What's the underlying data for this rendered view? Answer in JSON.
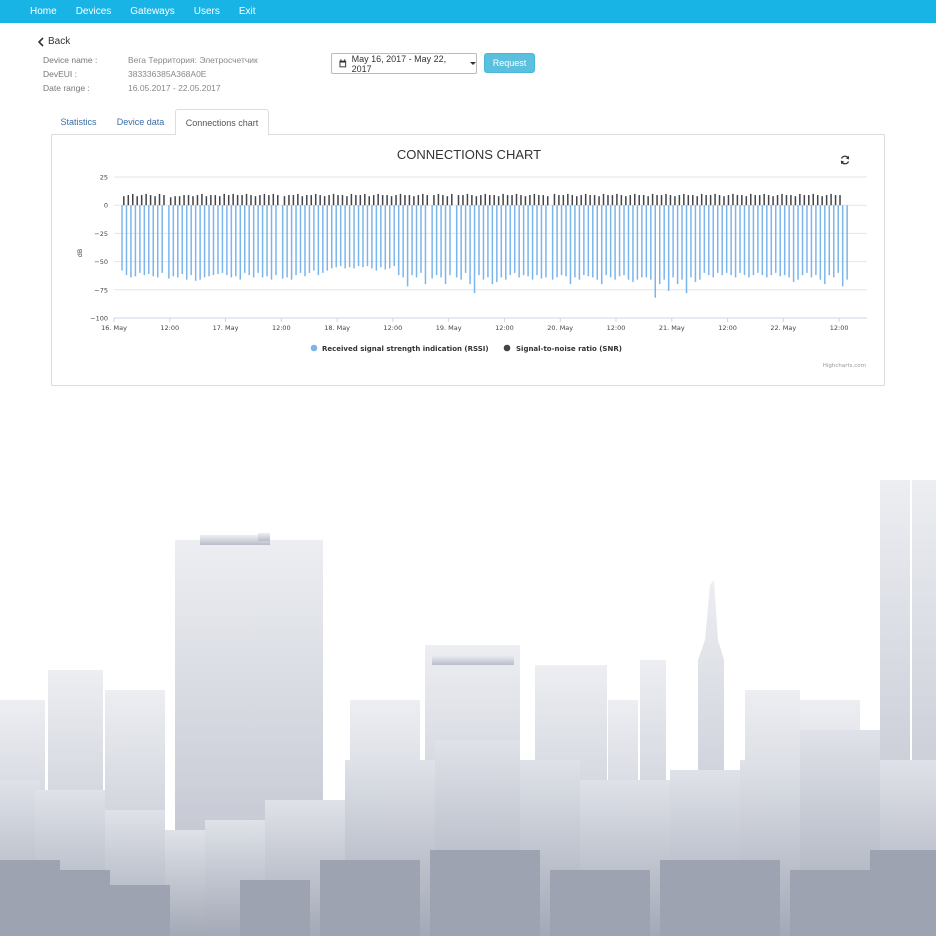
{
  "nav": {
    "items": [
      {
        "label": "Home"
      },
      {
        "label": "Devices"
      },
      {
        "label": "Gateways"
      },
      {
        "label": "Users"
      },
      {
        "label": "Exit"
      }
    ]
  },
  "back_label": "Back",
  "device_info": {
    "name_label": "Device name :",
    "name_value": "Вега Территория: Элетросчетчик",
    "deveui_label": "DevEUI :",
    "deveui_value": "383336385A368A0E",
    "range_label": "Date range :",
    "range_value": "16.05.2017 - 22.05.2017"
  },
  "date_picker": {
    "value": "May 16, 2017 - May 22, 2017",
    "icon": "calendar-icon"
  },
  "request_label": "Request",
  "tabs": [
    {
      "label": "Statistics",
      "active": false
    },
    {
      "label": "Device data",
      "active": false
    },
    {
      "label": "Connections chart",
      "active": true
    }
  ],
  "colors": {
    "navbar": "#17b4e5",
    "rssi": "#7cb5ec",
    "snr": "#434348",
    "button": "#5bc0de",
    "skyline": "#c4c8d2"
  },
  "chart_data": {
    "type": "bar",
    "title": "CONNECTIONS CHART",
    "ylabel": "dB",
    "ylim": [
      -100,
      25
    ],
    "yticks": [
      25,
      0,
      -25,
      -50,
      -75,
      -100
    ],
    "x_ticks": [
      "16. May",
      "12:00",
      "17. May",
      "12:00",
      "18. May",
      "12:00",
      "19. May",
      "12:00",
      "20. May",
      "12:00",
      "21. May",
      "12:00",
      "22. May",
      "12:00"
    ],
    "x_range_days": [
      0.0,
      6.75
    ],
    "grid": true,
    "legend_position": "bottom-center",
    "credits": "Highcharts.com",
    "series": [
      {
        "name": "Received signal strength indication (RSSI)",
        "day_offsets": [
          0.08,
          0.12,
          0.16,
          0.2,
          0.24,
          0.28,
          0.32,
          0.36,
          0.4,
          0.44,
          0.5,
          0.54,
          0.58,
          0.62,
          0.66,
          0.7,
          0.74,
          0.78,
          0.82,
          0.86,
          0.9,
          0.94,
          0.98,
          1.02,
          1.06,
          1.1,
          1.14,
          1.18,
          1.22,
          1.26,
          1.3,
          1.34,
          1.38,
          1.42,
          1.46,
          1.52,
          1.56,
          1.6,
          1.64,
          1.68,
          1.72,
          1.76,
          1.8,
          1.84,
          1.88,
          1.92,
          1.96,
          2.0,
          2.04,
          2.08,
          2.12,
          2.16,
          2.2,
          2.24,
          2.28,
          2.32,
          2.36,
          2.4,
          2.44,
          2.48,
          2.52,
          2.56,
          2.6,
          2.64,
          2.68,
          2.72,
          2.76,
          2.8,
          2.86,
          2.9,
          2.94,
          2.98,
          3.02,
          3.08,
          3.12,
          3.16,
          3.2,
          3.24,
          3.28,
          3.32,
          3.36,
          3.4,
          3.44,
          3.48,
          3.52,
          3.56,
          3.6,
          3.64,
          3.68,
          3.72,
          3.76,
          3.8,
          3.84,
          3.88,
          3.94,
          3.98,
          4.02,
          4.06,
          4.1,
          4.14,
          4.18,
          4.22,
          4.26,
          4.3,
          4.34,
          4.38,
          4.42,
          4.46,
          4.5,
          4.54,
          4.58,
          4.62,
          4.66,
          4.7,
          4.74,
          4.78,
          4.82,
          4.86,
          4.9,
          4.94,
          4.98,
          5.02,
          5.06,
          5.1,
          5.14,
          5.18,
          5.22,
          5.26,
          5.3,
          5.34,
          5.38,
          5.42,
          5.46,
          5.5,
          5.54,
          5.58,
          5.62,
          5.66,
          5.7,
          5.74,
          5.78,
          5.82,
          5.86,
          5.9,
          5.94,
          5.98,
          6.02,
          6.06,
          6.1,
          6.14,
          6.18,
          6.22,
          6.26,
          6.3,
          6.34,
          6.38,
          6.42,
          6.46,
          6.5,
          6.54,
          6.58,
          6.62,
          6.66,
          6.7
        ],
        "values": [
          -58,
          -62,
          -64,
          -63,
          -60,
          -62,
          -61,
          -63,
          -64,
          -60,
          -65,
          -63,
          -64,
          -61,
          -66,
          -62,
          -67,
          -66,
          -64,
          -63,
          -62,
          -61,
          -60,
          -62,
          -64,
          -63,
          -66,
          -60,
          -62,
          -64,
          -60,
          -64,
          -63,
          -66,
          -62,
          -65,
          -64,
          -66,
          -62,
          -60,
          -63,
          -60,
          -58,
          -62,
          -60,
          -58,
          -56,
          -55,
          -54,
          -56,
          -55,
          -56,
          -54,
          -55,
          -54,
          -56,
          -58,
          -55,
          -57,
          -56,
          -54,
          -62,
          -64,
          -72,
          -62,
          -64,
          -60,
          -70,
          -65,
          -62,
          -64,
          -70,
          -62,
          -64,
          -66,
          -60,
          -70,
          -78,
          -62,
          -66,
          -64,
          -70,
          -68,
          -64,
          -66,
          -62,
          -60,
          -64,
          -62,
          -63,
          -66,
          -62,
          -65,
          -64,
          -66,
          -64,
          -62,
          -63,
          -70,
          -64,
          -66,
          -62,
          -63,
          -64,
          -66,
          -70,
          -62,
          -64,
          -66,
          -63,
          -62,
          -66,
          -68,
          -66,
          -64,
          -64,
          -66,
          -82,
          -70,
          -66,
          -76,
          -64,
          -70,
          -66,
          -78,
          -64,
          -68,
          -66,
          -60,
          -62,
          -64,
          -60,
          -62,
          -60,
          -62,
          -64,
          -60,
          -62,
          -64,
          -62,
          -60,
          -62,
          -64,
          -62,
          -60,
          -63,
          -62,
          -64,
          -68,
          -66,
          -62,
          -60,
          -64,
          -62,
          -66,
          -70,
          -62,
          -64,
          -60,
          -72,
          -66
        ]
      },
      {
        "name": "Signal-to-noise ratio (SNR)",
        "day_offsets": [
          0.08,
          0.12,
          0.16,
          0.2,
          0.24,
          0.28,
          0.32,
          0.36,
          0.4,
          0.44,
          0.5,
          0.54,
          0.58,
          0.62,
          0.66,
          0.7,
          0.74,
          0.78,
          0.82,
          0.86,
          0.9,
          0.94,
          0.98,
          1.02,
          1.06,
          1.1,
          1.14,
          1.18,
          1.22,
          1.26,
          1.3,
          1.34,
          1.38,
          1.42,
          1.46,
          1.52,
          1.56,
          1.6,
          1.64,
          1.68,
          1.72,
          1.76,
          1.8,
          1.84,
          1.88,
          1.92,
          1.96,
          2.0,
          2.04,
          2.08,
          2.12,
          2.16,
          2.2,
          2.24,
          2.28,
          2.32,
          2.36,
          2.4,
          2.44,
          2.48,
          2.52,
          2.56,
          2.6,
          2.64,
          2.68,
          2.72,
          2.76,
          2.8,
          2.86,
          2.9,
          2.94,
          2.98,
          3.02,
          3.08,
          3.12,
          3.16,
          3.2,
          3.24,
          3.28,
          3.32,
          3.36,
          3.4,
          3.44,
          3.48,
          3.52,
          3.56,
          3.6,
          3.64,
          3.68,
          3.72,
          3.76,
          3.8,
          3.84,
          3.88,
          3.94,
          3.98,
          4.02,
          4.06,
          4.1,
          4.14,
          4.18,
          4.22,
          4.26,
          4.3,
          4.34,
          4.38,
          4.42,
          4.46,
          4.5,
          4.54,
          4.58,
          4.62,
          4.66,
          4.7,
          4.74,
          4.78,
          4.82,
          4.86,
          4.9,
          4.94,
          4.98,
          5.02,
          5.06,
          5.1,
          5.14,
          5.18,
          5.22,
          5.26,
          5.3,
          5.34,
          5.38,
          5.42,
          5.46,
          5.5,
          5.54,
          5.58,
          5.62,
          5.66,
          5.7,
          5.74,
          5.78,
          5.82,
          5.86,
          5.9,
          5.94,
          5.98,
          6.02,
          6.06,
          6.1,
          6.14,
          6.18,
          6.22,
          6.26,
          6.3,
          6.34,
          6.38,
          6.42,
          6.46,
          6.5,
          6.54,
          6.58,
          6.62,
          6.66,
          6.7
        ],
        "values": [
          8,
          9,
          10,
          8,
          9,
          10,
          9,
          8,
          10,
          9,
          7,
          8,
          8,
          9,
          9,
          8,
          9,
          10,
          8,
          9,
          9,
          8,
          10,
          9,
          10,
          9,
          9,
          10,
          9,
          8,
          9,
          10,
          9,
          10,
          9,
          8,
          9,
          9,
          10,
          8,
          9,
          9,
          10,
          9,
          8,
          9,
          10,
          9,
          9,
          8,
          10,
          9,
          9,
          10,
          8,
          9,
          10,
          9,
          9,
          8,
          9,
          10,
          9,
          9,
          8,
          9,
          10,
          9,
          9,
          10,
          9,
          8,
          10,
          9,
          9,
          10,
          9,
          8,
          9,
          10,
          9,
          9,
          8,
          10,
          9,
          9,
          10,
          9,
          8,
          9,
          10,
          9,
          9,
          8,
          10,
          9,
          9,
          10,
          9,
          8,
          9,
          10,
          9,
          9,
          8,
          10,
          9,
          9,
          10,
          9,
          8,
          9,
          10,
          9,
          9,
          8,
          10,
          9,
          9,
          10,
          9,
          8,
          9,
          10,
          9,
          9,
          8,
          10,
          9,
          9,
          10,
          9,
          8,
          9,
          10,
          9,
          9,
          8,
          10,
          9,
          9,
          10,
          9,
          8,
          9,
          10,
          9,
          9,
          8,
          10,
          9,
          9,
          10,
          9,
          8,
          9,
          10,
          9,
          9
        ]
      }
    ]
  }
}
